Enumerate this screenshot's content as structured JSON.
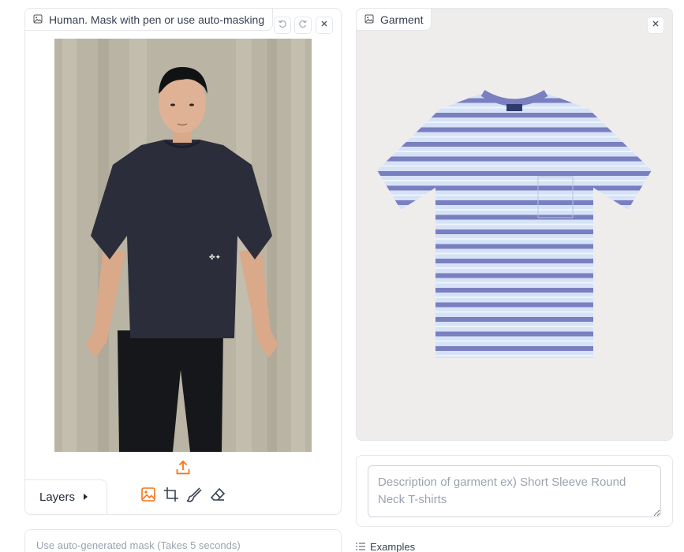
{
  "human_panel": {
    "label": "Human. Mask with pen or use auto-masking",
    "icons": [
      "image-icon",
      "undo-icon",
      "redo-icon",
      "close-icon"
    ],
    "toolbar": {
      "layers_label": "Layers",
      "tools": [
        "image-tool-icon",
        "crop-icon",
        "brush-icon",
        "eraser-icon"
      ]
    }
  },
  "garment_panel": {
    "label": "Garment"
  },
  "description": {
    "placeholder": "Description of garment ex) Short Sleeve Round Neck T-shirts",
    "value": ""
  },
  "auto_mask": {
    "label": "Use auto-generated mask (Takes 5 seconds)"
  },
  "examples": {
    "label": "Examples"
  },
  "colors": {
    "accent": "#f97316",
    "border": "#e5e7eb",
    "garment_bg": "#eeedec",
    "stripe_blue": "#7a7fc0",
    "stripe_light": "#c9d9f2"
  }
}
